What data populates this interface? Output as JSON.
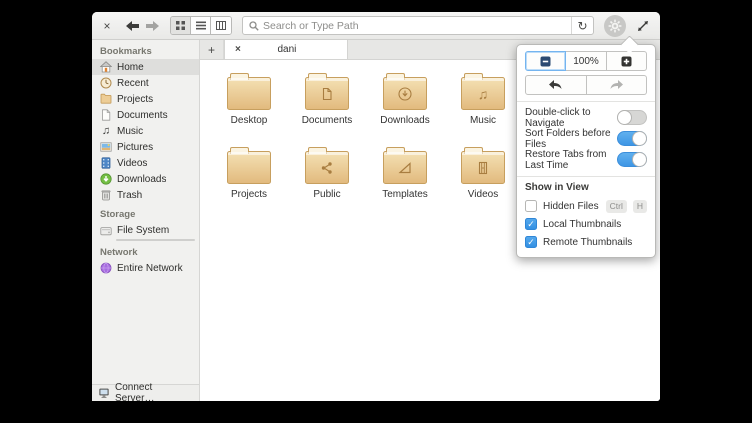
{
  "icons": {
    "close": "×",
    "plus": "+",
    "refresh": "↻",
    "check": "✓",
    "music_note": "♫"
  },
  "toolbar": {
    "search_placeholder": "Search or Type Path"
  },
  "tabbar": {
    "active_tab": "dani"
  },
  "sidebar": {
    "sections": [
      {
        "header": "Bookmarks",
        "items": [
          {
            "label": "Home",
            "selected": true
          },
          {
            "label": "Recent"
          },
          {
            "label": "Projects"
          },
          {
            "label": "Documents"
          },
          {
            "label": "Music"
          },
          {
            "label": "Pictures"
          },
          {
            "label": "Videos"
          },
          {
            "label": "Downloads"
          },
          {
            "label": "Trash"
          }
        ]
      },
      {
        "header": "Storage",
        "items": [
          {
            "label": "File System",
            "usage_percent": 34
          }
        ]
      },
      {
        "header": "Network",
        "items": [
          {
            "label": "Entire Network"
          }
        ]
      }
    ],
    "connect_server_label": "Connect Server…"
  },
  "folders": [
    {
      "label": "Desktop",
      "glyph": "none"
    },
    {
      "label": "Documents",
      "glyph": "document"
    },
    {
      "label": "Downloads",
      "glyph": "download-circle"
    },
    {
      "label": "Music",
      "glyph": "music-note"
    },
    {
      "label": "Projects",
      "glyph": "none"
    },
    {
      "label": "Public",
      "glyph": "share"
    },
    {
      "label": "Templates",
      "glyph": "set-square"
    },
    {
      "label": "Videos",
      "glyph": "film-strip"
    }
  ],
  "popover": {
    "zoom_level": "100%",
    "toggles": [
      {
        "label": "Double-click to Navigate",
        "on": false
      },
      {
        "label": "Sort Folders before Files",
        "on": true
      },
      {
        "label": "Restore Tabs from Last Time",
        "on": true
      }
    ],
    "show_in_view": {
      "header": "Show in View",
      "items": [
        {
          "label": "Hidden Files",
          "checked": false,
          "shortcut": [
            "Ctrl",
            "H"
          ]
        },
        {
          "label": "Local Thumbnails",
          "checked": true
        },
        {
          "label": "Remote Thumbnails",
          "checked": true
        }
      ]
    }
  },
  "colors": {
    "accent_blue": "#3a96e6",
    "folder_tan": "#e9c68f",
    "folder_border": "#c79f5e",
    "sidebar_bg": "#f1f1ef",
    "toolbar_bg": "#f0f0ee"
  }
}
